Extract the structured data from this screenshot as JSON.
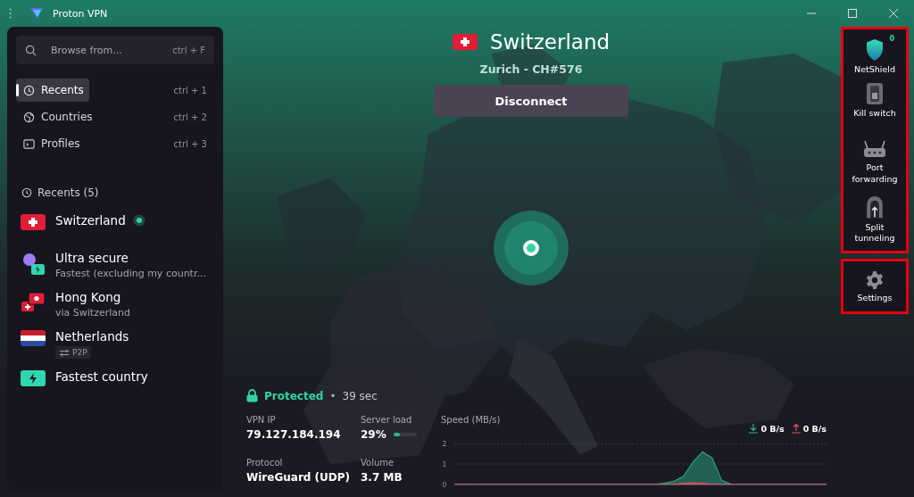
{
  "window": {
    "title": "Proton VPN"
  },
  "search": {
    "placeholder": "Browse from...",
    "shortcut": "ctrl + F"
  },
  "nav": [
    {
      "label": "Recents",
      "shortcut": "ctrl + 1",
      "selected": true,
      "kind": "recents"
    },
    {
      "label": "Countries",
      "shortcut": "ctrl + 2",
      "selected": false,
      "kind": "countries"
    },
    {
      "label": "Profiles",
      "shortcut": "ctrl + 3",
      "selected": false,
      "kind": "profiles"
    }
  ],
  "recents": {
    "title": "Recents (5)",
    "items": [
      {
        "name": "Switzerland",
        "kind": "flag-ch",
        "connected": true
      },
      {
        "name": "Ultra secure",
        "detail": "Fastest (excluding my countr...",
        "kind": "profile",
        "connected": false
      },
      {
        "name": "Hong Kong",
        "detail": "via Switzerland",
        "kind": "secure-core",
        "connected": false
      },
      {
        "name": "Netherlands",
        "tag": "P2P",
        "kind": "flag-nl",
        "connected": false
      },
      {
        "name": "Fastest country",
        "kind": "fastest",
        "connected": false
      }
    ]
  },
  "connection": {
    "country": "Switzerland",
    "server": "Zurich - CH#576",
    "button": "Disconnect",
    "status": "Protected",
    "separator": "•",
    "duration": "39 sec"
  },
  "stats": [
    {
      "label": "VPN IP",
      "value": "79.127.184.194"
    },
    {
      "label": "Server load",
      "value": "29%",
      "level": 0.29
    },
    {
      "label": "Protocol",
      "value": "WireGuard (UDP)"
    },
    {
      "label": "Volume",
      "value": "3.7 MB"
    }
  ],
  "speed": {
    "download": "0 B/s",
    "upload": "0 B/s",
    "chart_data": {
      "type": "area",
      "ylabel": "Speed (MB/s)",
      "ylim": [
        0,
        2
      ],
      "yticks": [
        0,
        1,
        2
      ],
      "series": [
        {
          "color": "#2fb592",
          "values": [
            0,
            0,
            0,
            0,
            0,
            0,
            0,
            0,
            0,
            0,
            0,
            0,
            0,
            0,
            0,
            0,
            0,
            0,
            0,
            0,
            0,
            0,
            0.05,
            0.15,
            0.4,
            1.1,
            1.6,
            1.3,
            0.2,
            0,
            0,
            0,
            0,
            0,
            0,
            0,
            0,
            0,
            0,
            0
          ]
        },
        {
          "color": "#e0505f",
          "values": [
            0,
            0,
            0,
            0,
            0,
            0,
            0,
            0,
            0,
            0,
            0,
            0,
            0,
            0,
            0,
            0,
            0,
            0,
            0,
            0,
            0,
            0,
            0,
            0,
            0.05,
            0.08,
            0.05,
            0,
            0,
            0,
            0,
            0,
            0,
            0,
            0,
            0,
            0,
            0,
            0,
            0
          ]
        }
      ]
    }
  },
  "features": [
    {
      "label": "NetShield",
      "kind": "netshield",
      "badge": "0"
    },
    {
      "label": "Kill switch",
      "kind": "killswitch"
    },
    {
      "label": "Port forwarding",
      "kind": "port"
    },
    {
      "label": "Split tunneling",
      "kind": "split"
    }
  ],
  "settings": {
    "label": "Settings"
  }
}
